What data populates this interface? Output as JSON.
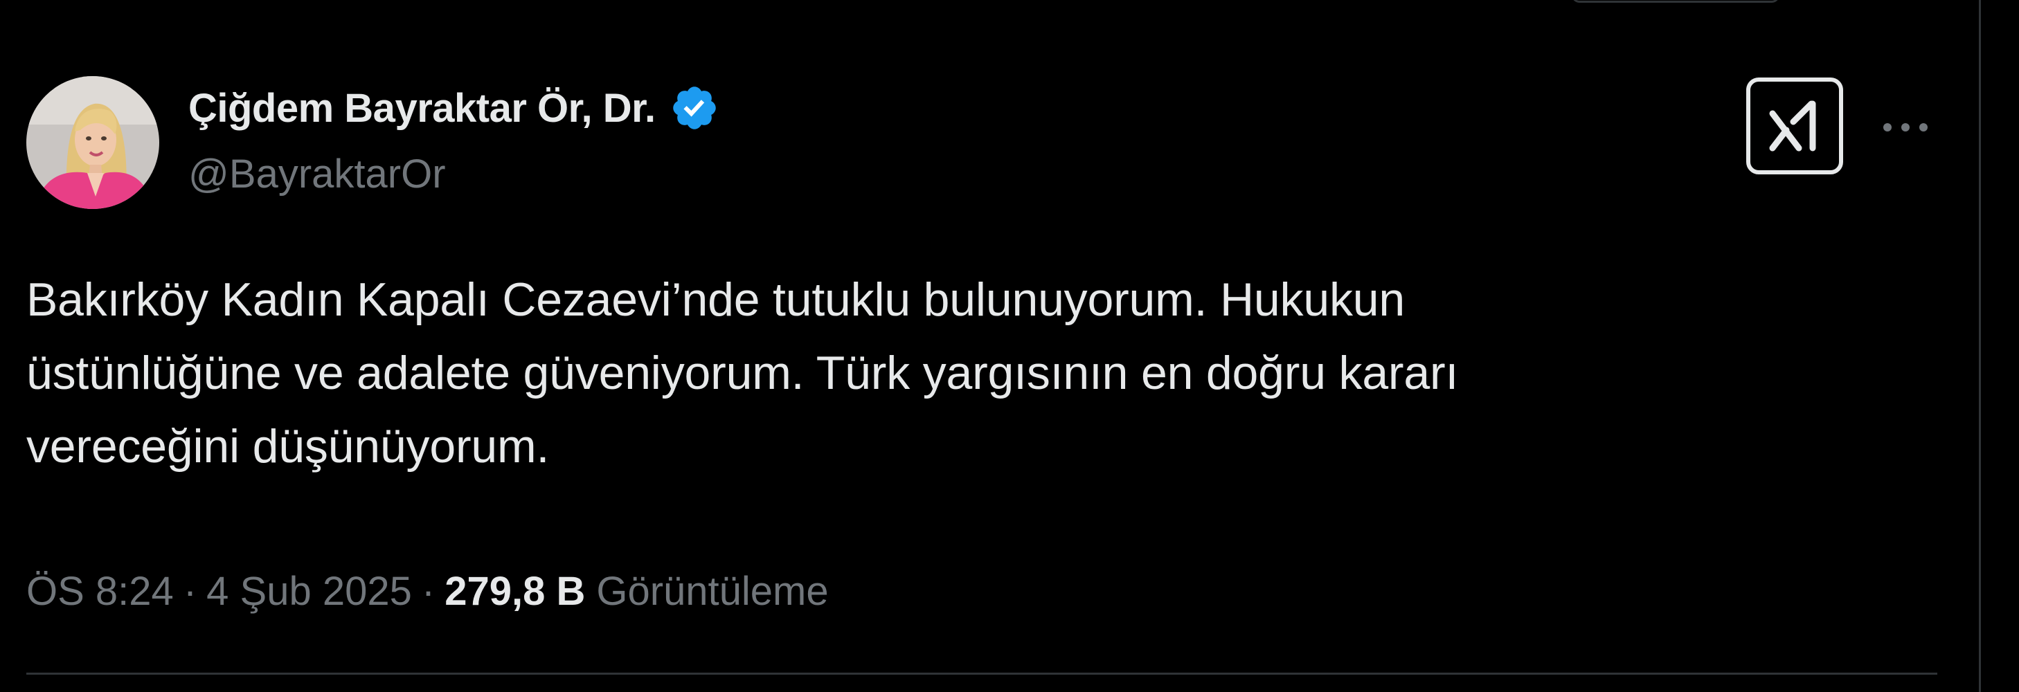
{
  "author": {
    "display_name": "Çiğdem Bayraktar Ör, Dr.",
    "handle": "@BayraktarOr",
    "verified_icon": "verified-badge-icon",
    "avatar_icon": "profile-avatar"
  },
  "actions": {
    "grok_icon": "grok-icon",
    "more_icon": "more-options-icon"
  },
  "tweet": {
    "lines": [
      "Bakırköy Kadın Kapalı Cezaevi’nde tutuklu bulunuyorum. Hukukun",
      "üstünlüğüne ve adalete güveniyorum. Türk yargısının en doğru kararı",
      "vereceğini düşünüyorum."
    ]
  },
  "meta": {
    "time": "ÖS 8:24",
    "separator": "·",
    "date": "4 Şub 2025",
    "views_count": "279,8 B",
    "views_label": "Görüntüleme"
  },
  "colors": {
    "background": "#000000",
    "primary_text": "#e7e9ea",
    "secondary_text": "#71767b",
    "verified_blue": "#1d9bf0",
    "divider": "#2f3336"
  }
}
